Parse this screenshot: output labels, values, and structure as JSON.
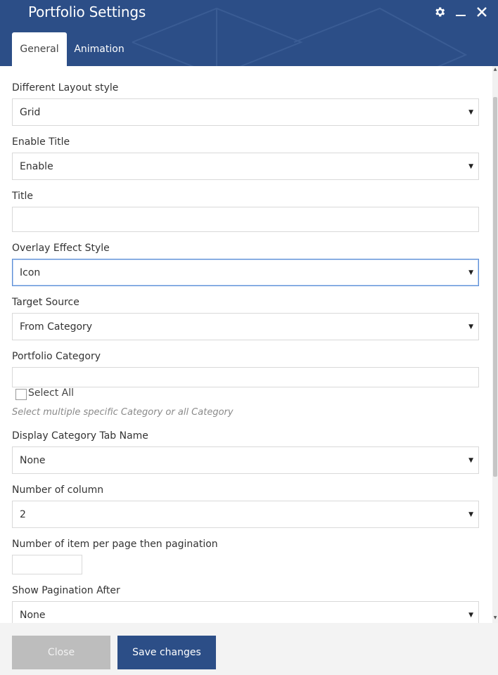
{
  "header": {
    "title": "Portfolio Settings",
    "icons": [
      "gear-icon",
      "minimize-icon",
      "close-icon"
    ],
    "tabs": [
      {
        "label": "General",
        "active": true
      },
      {
        "label": "Animation",
        "active": false
      }
    ]
  },
  "colors": {
    "header_bg": "#2c4e87",
    "save_button": "#2c4e87",
    "close_button": "#bdbdbd",
    "focus_border": "#5b8ed6"
  },
  "form": {
    "layout_style": {
      "label": "Different Layout style",
      "value": "Grid"
    },
    "enable_title": {
      "label": "Enable Title",
      "value": "Enable"
    },
    "title": {
      "label": "Title",
      "value": ""
    },
    "overlay_effect": {
      "label": "Overlay Effect Style",
      "value": "Icon"
    },
    "target_source": {
      "label": "Target Source",
      "value": "From Category"
    },
    "portfolio_category": {
      "label": "Portfolio Category",
      "value": "",
      "select_all_label": "Select All",
      "hint": "Select multiple specific Category or all Category"
    },
    "category_tab_name": {
      "label": "Display Category Tab Name",
      "value": "None"
    },
    "column_count": {
      "label": "Number of column",
      "value": "2"
    },
    "items_per_page": {
      "label": "Number of item per page then pagination",
      "value": ""
    },
    "pagination_after": {
      "label": "Show Pagination After",
      "value": "None"
    }
  },
  "footer": {
    "close_label": "Close",
    "save_label": "Save changes"
  }
}
